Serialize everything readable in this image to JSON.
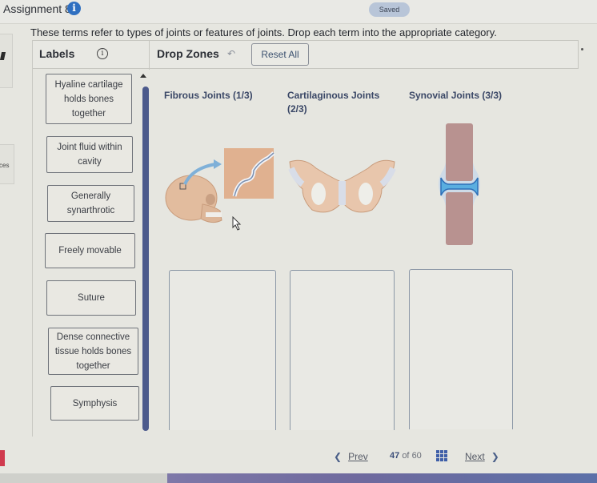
{
  "topbar": {
    "assignment_title": "Assignment 8",
    "info_icon": "info-icon",
    "status": "Saved"
  },
  "instructions": "These terms refer to types of joints or features of joints. Drop each term into the appropriate category.",
  "left_stub": {
    "partial_text": "ces"
  },
  "panel": {
    "labels_title": "Labels",
    "labels_info_icon": "info-circle-icon",
    "drop_zones_title": "Drop Zones",
    "undo_icon": "undo-arrow-icon",
    "reset_label": "Reset All"
  },
  "labels": [
    {
      "text": "Hyaline cartilage holds bones together"
    },
    {
      "text": "Joint fluid within cavity"
    },
    {
      "text": "Generally synarthrotic"
    },
    {
      "text": "Freely movable"
    },
    {
      "text": "Suture"
    },
    {
      "text": "Dense connective tissue holds bones together"
    },
    {
      "text": "Symphysis"
    }
  ],
  "categories": [
    {
      "name": "Fibrous Joints (1/3)",
      "image": "skull-suture-illustration"
    },
    {
      "name": "Cartilaginous Joints (2/3)",
      "image": "pubic-symphysis-illustration"
    },
    {
      "name": "Synovial Joints (3/3)",
      "image": "synovial-joint-illustration"
    }
  ],
  "footer": {
    "prev_label": "Prev",
    "current_page": "47",
    "of_label": "of",
    "total_pages": "60",
    "next_label": "Next"
  },
  "colors": {
    "accent": "#3e5ea8",
    "scrollbar": "#4c5a8c",
    "saved_pill": "#b8c5d8",
    "info_badge": "#2f6fc0"
  }
}
